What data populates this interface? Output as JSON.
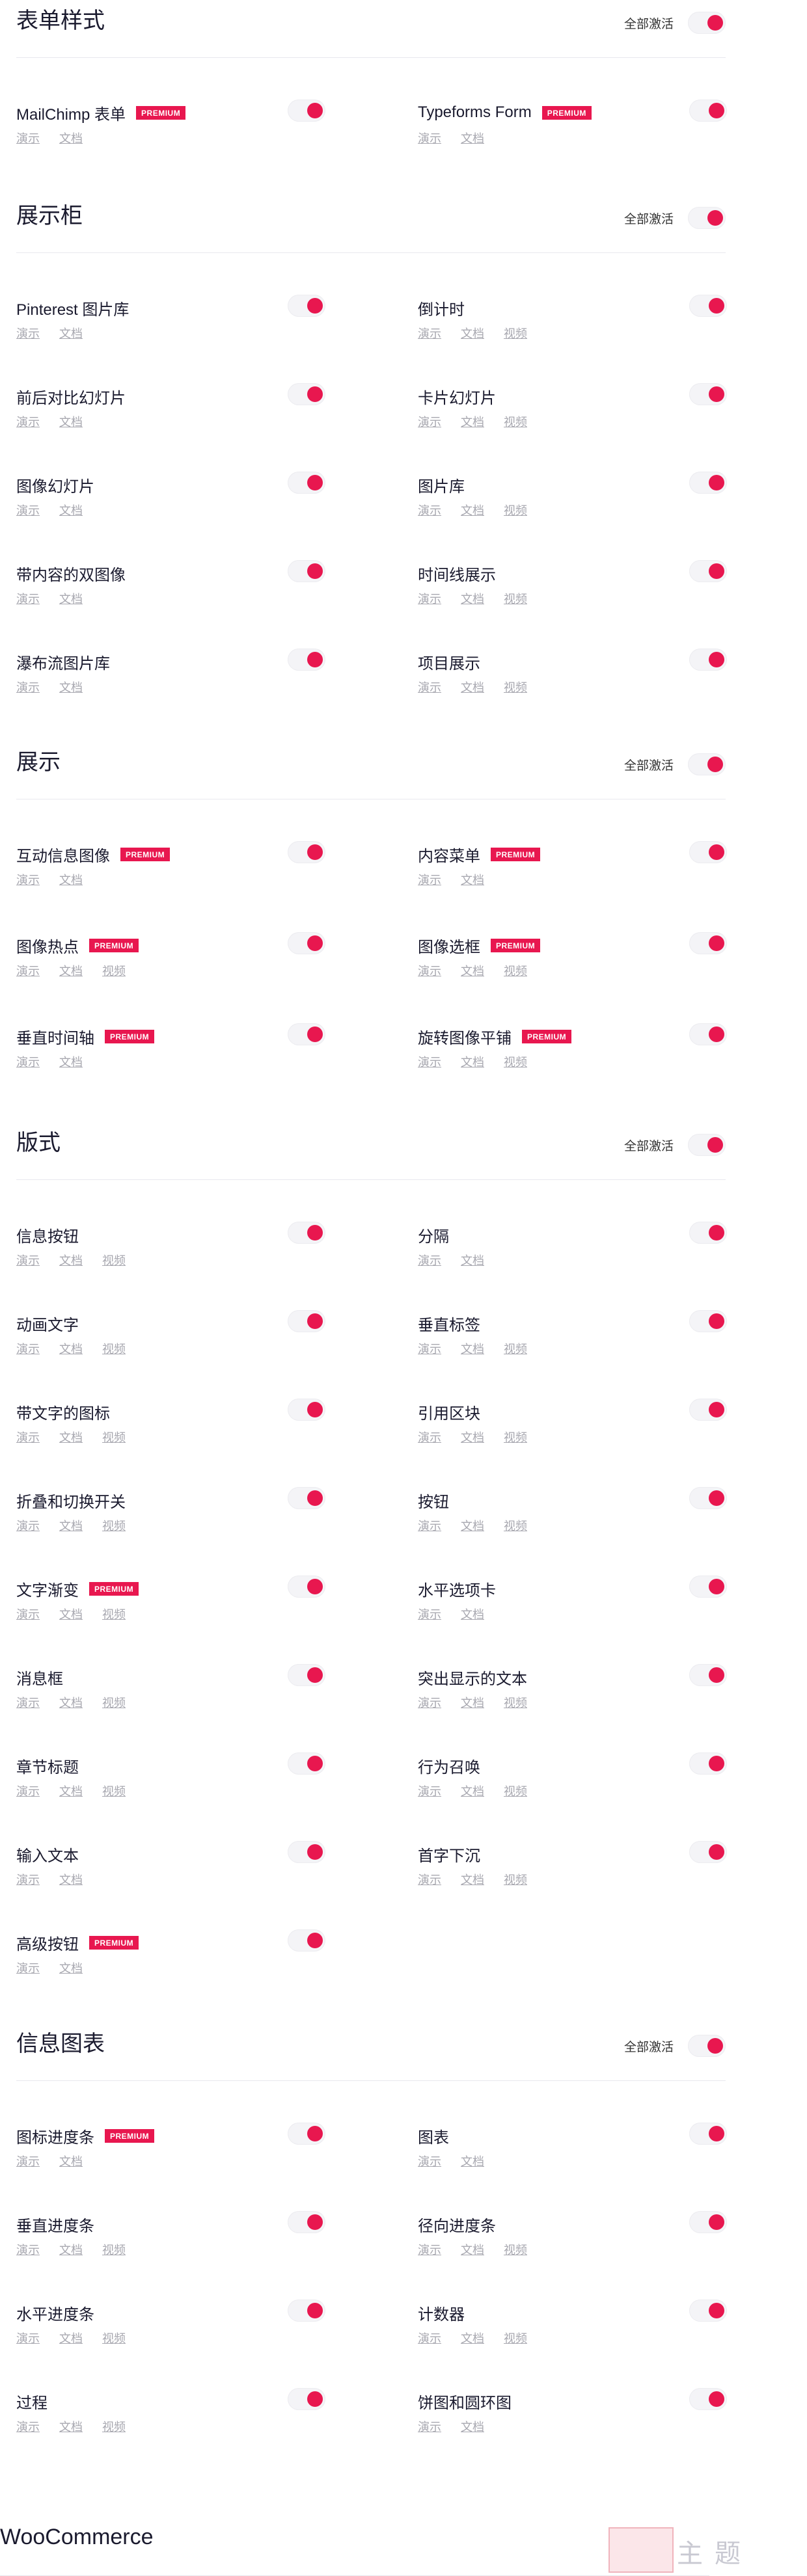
{
  "premium_label": "PREMIUM",
  "activate_all_label": "全部激活",
  "accent_color": "#e8174f",
  "sections": [
    {
      "title": "表单样式",
      "items": [
        {
          "name": "MailChimp 表单",
          "premium": true,
          "links": [
            "演示",
            "文档"
          ],
          "enabled": true
        },
        {
          "name": "Typeforms Form",
          "premium": true,
          "links": [
            "演示",
            "文档"
          ],
          "enabled": true
        }
      ]
    },
    {
      "title": "展示柜",
      "items": [
        {
          "name": "Pinterest 图片库",
          "premium": false,
          "links": [
            "演示",
            "文档"
          ],
          "enabled": true
        },
        {
          "name": "倒计时",
          "premium": false,
          "links": [
            "演示",
            "文档",
            "视频"
          ],
          "enabled": true
        },
        {
          "name": "前后对比幻灯片",
          "premium": false,
          "links": [
            "演示",
            "文档"
          ],
          "enabled": true
        },
        {
          "name": "卡片幻灯片",
          "premium": false,
          "links": [
            "演示",
            "文档",
            "视频"
          ],
          "enabled": true
        },
        {
          "name": "图像幻灯片",
          "premium": false,
          "links": [
            "演示",
            "文档"
          ],
          "enabled": true
        },
        {
          "name": "图片库",
          "premium": false,
          "links": [
            "演示",
            "文档",
            "视频"
          ],
          "enabled": true
        },
        {
          "name": "带内容的双图像",
          "premium": false,
          "links": [
            "演示",
            "文档"
          ],
          "enabled": true
        },
        {
          "name": "时间线展示",
          "premium": false,
          "links": [
            "演示",
            "文档",
            "视频"
          ],
          "enabled": true
        },
        {
          "name": "瀑布流图片库",
          "premium": false,
          "links": [
            "演示",
            "文档"
          ],
          "enabled": true
        },
        {
          "name": "项目展示",
          "premium": false,
          "links": [
            "演示",
            "文档",
            "视频"
          ],
          "enabled": true
        }
      ]
    },
    {
      "title": "展示",
      "items": [
        {
          "name": "互动信息图像",
          "premium": true,
          "links": [
            "演示",
            "文档"
          ],
          "enabled": true
        },
        {
          "name": "内容菜单",
          "premium": true,
          "links": [
            "演示",
            "文档"
          ],
          "enabled": true
        },
        {
          "name": "图像热点",
          "premium": true,
          "links": [
            "演示",
            "文档",
            "视频"
          ],
          "enabled": true
        },
        {
          "name": "图像选框",
          "premium": true,
          "links": [
            "演示",
            "文档",
            "视频"
          ],
          "enabled": true
        },
        {
          "name": "垂直时间轴",
          "premium": true,
          "links": [
            "演示",
            "文档"
          ],
          "enabled": true
        },
        {
          "name": "旋转图像平铺",
          "premium": true,
          "links": [
            "演示",
            "文档",
            "视频"
          ],
          "enabled": true
        }
      ]
    },
    {
      "title": "版式",
      "items": [
        {
          "name": "信息按钮",
          "premium": false,
          "links": [
            "演示",
            "文档",
            "视频"
          ],
          "enabled": true
        },
        {
          "name": "分隔",
          "premium": false,
          "links": [
            "演示",
            "文档"
          ],
          "enabled": true
        },
        {
          "name": "动画文字",
          "premium": false,
          "links": [
            "演示",
            "文档",
            "视频"
          ],
          "enabled": true
        },
        {
          "name": "垂直标签",
          "premium": false,
          "links": [
            "演示",
            "文档",
            "视频"
          ],
          "enabled": true
        },
        {
          "name": "带文字的图标",
          "premium": false,
          "links": [
            "演示",
            "文档",
            "视频"
          ],
          "enabled": true
        },
        {
          "name": "引用区块",
          "premium": false,
          "links": [
            "演示",
            "文档",
            "视频"
          ],
          "enabled": true
        },
        {
          "name": "折叠和切换开关",
          "premium": false,
          "links": [
            "演示",
            "文档",
            "视频"
          ],
          "enabled": true
        },
        {
          "name": "按钮",
          "premium": false,
          "links": [
            "演示",
            "文档",
            "视频"
          ],
          "enabled": true
        },
        {
          "name": "文字渐变",
          "premium": true,
          "links": [
            "演示",
            "文档",
            "视频"
          ],
          "enabled": true
        },
        {
          "name": "水平选项卡",
          "premium": false,
          "links": [
            "演示",
            "文档"
          ],
          "enabled": true
        },
        {
          "name": "消息框",
          "premium": false,
          "links": [
            "演示",
            "文档",
            "视频"
          ],
          "enabled": true
        },
        {
          "name": "突出显示的文本",
          "premium": false,
          "links": [
            "演示",
            "文档",
            "视频"
          ],
          "enabled": true
        },
        {
          "name": "章节标题",
          "premium": false,
          "links": [
            "演示",
            "文档",
            "视频"
          ],
          "enabled": true
        },
        {
          "name": "行为召唤",
          "premium": false,
          "links": [
            "演示",
            "文档",
            "视频"
          ],
          "enabled": true
        },
        {
          "name": "输入文本",
          "premium": false,
          "links": [
            "演示",
            "文档"
          ],
          "enabled": true
        },
        {
          "name": "首字下沉",
          "premium": false,
          "links": [
            "演示",
            "文档",
            "视频"
          ],
          "enabled": true
        },
        {
          "name": "高级按钮",
          "premium": true,
          "links": [
            "演示",
            "文档"
          ],
          "enabled": true
        }
      ]
    },
    {
      "title": "信息图表",
      "items": [
        {
          "name": "图标进度条",
          "premium": true,
          "links": [
            "演示",
            "文档"
          ],
          "enabled": true
        },
        {
          "name": "图表",
          "premium": false,
          "links": [
            "演示",
            "文档"
          ],
          "enabled": true
        },
        {
          "name": "垂直进度条",
          "premium": false,
          "links": [
            "演示",
            "文档",
            "视频"
          ],
          "enabled": true
        },
        {
          "name": "径向进度条",
          "premium": false,
          "links": [
            "演示",
            "文档",
            "视频"
          ],
          "enabled": true
        },
        {
          "name": "水平进度条",
          "premium": false,
          "links": [
            "演示",
            "文档",
            "视频"
          ],
          "enabled": true
        },
        {
          "name": "计数器",
          "premium": false,
          "links": [
            "演示",
            "文档",
            "视频"
          ],
          "enabled": true
        },
        {
          "name": "过程",
          "premium": false,
          "links": [
            "演示",
            "文档",
            "视频"
          ],
          "enabled": true
        },
        {
          "name": "饼图和圆环图",
          "premium": false,
          "links": [
            "演示",
            "文档"
          ],
          "enabled": true
        }
      ]
    }
  ],
  "woocommerce_title": "WooCommerce"
}
